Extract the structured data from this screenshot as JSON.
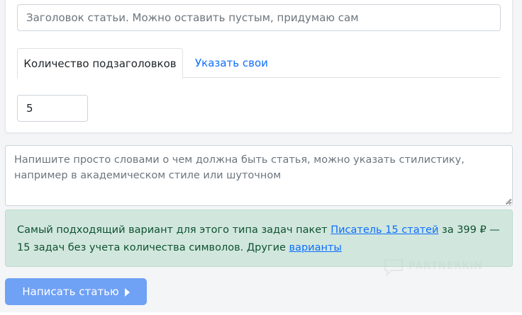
{
  "article_form": {
    "title_input": {
      "value": "",
      "placeholder": "Заголовок статьи. Можно оставить пустым, придумаю сам"
    },
    "tabs": [
      {
        "label": "Количество подзаголовков",
        "active": true
      },
      {
        "label": "Указать свои",
        "active": false
      }
    ],
    "subheadings_count": "5"
  },
  "description": {
    "value": "",
    "placeholder": "Напишите просто словами о чем должна быть статья, можно указать стилистику, например в академическом стиле или шуточном"
  },
  "recommendation": {
    "text_before": "Самый подходящий вариант для этого типа задач пакет ",
    "package_link": "Писатель 15 статей",
    "text_middle": " за 399 ₽ — 15 задач без учета количества символов. Другие ",
    "variants_link": "варианты"
  },
  "watermark": {
    "text": "PARTNERKIN"
  },
  "submit": {
    "label": "Написать статью",
    "icon": "play-icon"
  },
  "colors": {
    "accent": "#0d6efd",
    "button": "#6fa1f5",
    "alert_bg": "#d1e7dd",
    "alert_text": "#0f5132"
  }
}
